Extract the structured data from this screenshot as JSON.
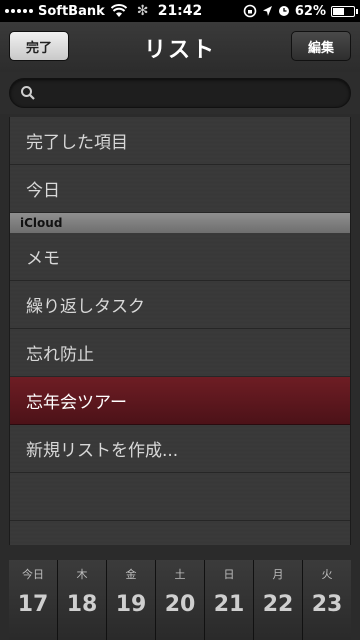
{
  "status_bar": {
    "carrier": "SoftBank",
    "time": "21:42",
    "battery": "62%",
    "battery_level": 0.62,
    "icons": [
      "signal-dots-icon",
      "wifi-icon",
      "activity-spinner-icon",
      "rotation-lock-icon",
      "location-arrow-icon",
      "alarm-icon",
      "battery-icon"
    ]
  },
  "nav": {
    "title": "リスト",
    "done_label": "完了",
    "edit_label": "編集"
  },
  "search": {
    "placeholder": "",
    "value": ""
  },
  "list": {
    "rows_top": [
      "完了した項目",
      "今日"
    ],
    "section_header": "iCloud",
    "rows_icloud": [
      "メモ",
      "繰り返しタスク",
      "忘れ防止",
      "忘年会ツアー",
      "新規リストを作成..."
    ],
    "selected": "忘年会ツアー"
  },
  "days": [
    {
      "dow": "今日",
      "date": "17"
    },
    {
      "dow": "木",
      "date": "18"
    },
    {
      "dow": "金",
      "date": "19"
    },
    {
      "dow": "土",
      "date": "20"
    },
    {
      "dow": "日",
      "date": "21"
    },
    {
      "dow": "月",
      "date": "22"
    },
    {
      "dow": "火",
      "date": "23"
    }
  ],
  "colors": {
    "selected_row": "#5a161c",
    "background": "#2b2b2b"
  }
}
